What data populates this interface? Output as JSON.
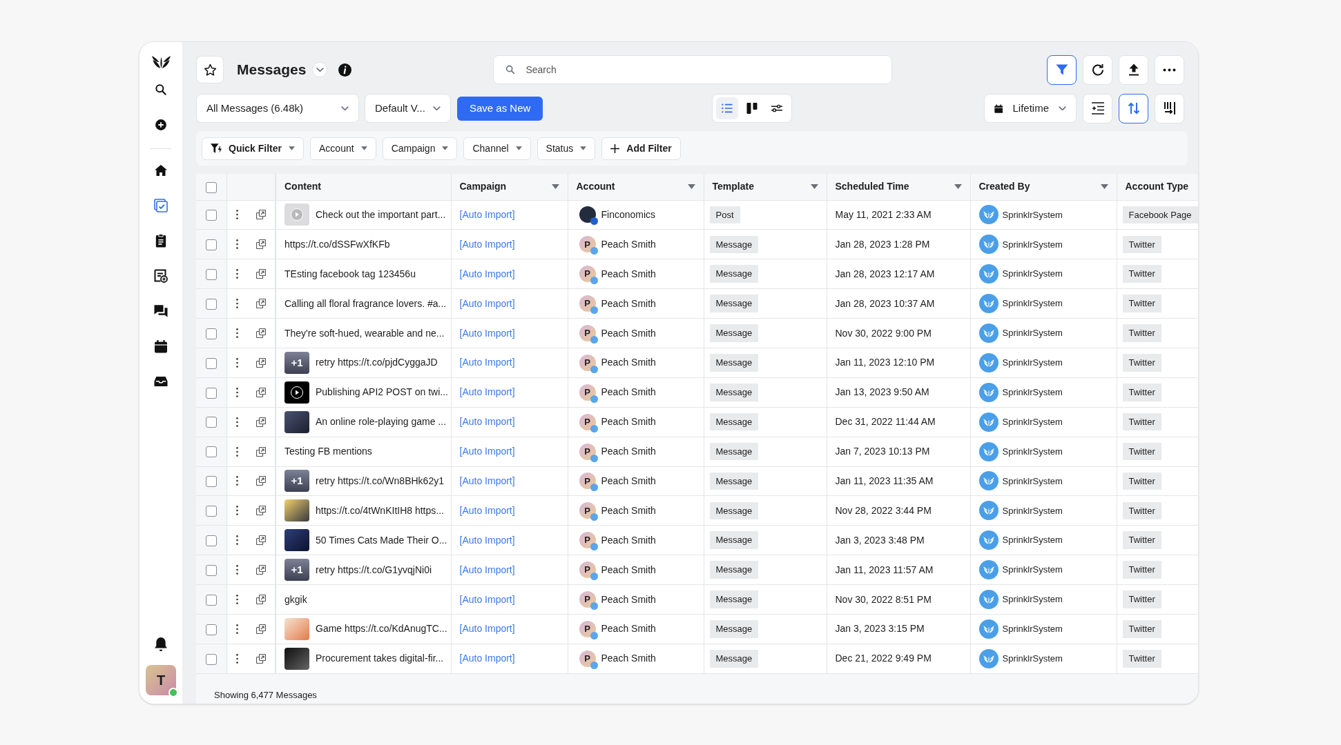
{
  "sidebar": {
    "items": [
      {
        "selected": false
      },
      {
        "selected": false
      },
      {
        "selected": false
      },
      {
        "selected": true
      },
      {
        "selected": false
      },
      {
        "selected": false
      },
      {
        "selected": false
      },
      {
        "selected": false
      },
      {
        "selected": false
      }
    ],
    "avatar_initial": "T",
    "online": true
  },
  "header": {
    "title": "Messages",
    "search": {
      "placeholder": "Search"
    },
    "actions": [
      {
        "active": true
      },
      {
        "active": false
      },
      {
        "active": false
      },
      {
        "active": false
      }
    ]
  },
  "toolbar": {
    "view_select": "All Messages (6.48k)",
    "preset_select": "Default V...",
    "save_button": "Save as New",
    "view_modes": [
      {
        "selected": true
      },
      {
        "selected": false
      },
      {
        "selected": false
      }
    ],
    "date_range": "Lifetime",
    "tools": [
      {
        "active": false
      },
      {
        "active": true
      },
      {
        "active": false
      }
    ]
  },
  "filters": [
    {
      "kind": "quick",
      "label": "Quick Filter"
    },
    {
      "kind": "dropdown",
      "label": "Account"
    },
    {
      "kind": "dropdown",
      "label": "Campaign"
    },
    {
      "kind": "dropdown",
      "label": "Channel"
    },
    {
      "kind": "dropdown",
      "label": "Status"
    },
    {
      "kind": "add",
      "label": "Add Filter"
    }
  ],
  "table": {
    "all_selected": false,
    "columns": [
      {
        "label": "Content",
        "sortable": false
      },
      {
        "label": "Campaign",
        "sortable": true
      },
      {
        "label": "Account",
        "sortable": true
      },
      {
        "label": "Template",
        "sortable": true
      },
      {
        "label": "Scheduled Time",
        "sortable": true
      },
      {
        "label": "Created By",
        "sortable": true
      },
      {
        "label": "Account Type",
        "sortable": false
      }
    ],
    "rows": [
      {
        "kind": "video",
        "checked": false,
        "content": "Check out the important part...",
        "campaign": "[Auto Import]",
        "account": {
          "name": "Finconomics",
          "color": "#1f5fd1"
        },
        "template": "Post",
        "scheduled": "May 11, 2021 2:33 AM",
        "created_by": "SprinklrSystem",
        "account_type": "Facebook Page"
      },
      {
        "kind": "text",
        "checked": false,
        "content": "https://t.co/dSSFwXfKFb",
        "campaign": "[Auto Import]",
        "account": {
          "name": "Peach Smith",
          "initial": "P",
          "color": "#5aa5ec"
        },
        "template": "Message",
        "scheduled": "Jan 28, 2023 1:28 PM",
        "created_by": "SprinklrSystem",
        "account_type": "Twitter"
      },
      {
        "kind": "text",
        "checked": false,
        "content": "TEsting facebook tag 123456u",
        "campaign": "[Auto Import]",
        "account": {
          "name": "Peach Smith",
          "initial": "P",
          "color": "#5aa5ec"
        },
        "template": "Message",
        "scheduled": "Jan 28, 2023 12:17 AM",
        "created_by": "SprinklrSystem",
        "account_type": "Twitter"
      },
      {
        "kind": "text",
        "checked": false,
        "content": "Calling all floral fragrance lovers. #a...",
        "campaign": "[Auto Import]",
        "account": {
          "name": "Peach Smith",
          "initial": "P",
          "color": "#5aa5ec"
        },
        "template": "Message",
        "scheduled": "Jan 28, 2023 10:37 AM",
        "created_by": "SprinklrSystem",
        "account_type": "Twitter"
      },
      {
        "kind": "text",
        "checked": false,
        "content": "They're soft-hued, wearable and ne...",
        "campaign": "[Auto Import]",
        "account": {
          "name": "Peach Smith",
          "initial": "P",
          "color": "#5aa5ec"
        },
        "template": "Message",
        "scheduled": "Nov 30, 2022 9:00 PM",
        "created_by": "SprinklrSystem",
        "account_type": "Twitter"
      },
      {
        "kind": "gallery",
        "badge": "+1",
        "checked": false,
        "content": "retry https://t.co/pjdCyggaJD",
        "campaign": "[Auto Import]",
        "account": {
          "name": "Peach Smith",
          "initial": "P",
          "color": "#5aa5ec"
        },
        "template": "Message",
        "scheduled": "Jan 11, 2023 12:10 PM",
        "created_by": "SprinklrSystem",
        "account_type": "Twitter"
      },
      {
        "kind": "video",
        "checked": false,
        "content": "Publishing API2 POST on twi...",
        "campaign": "[Auto Import]",
        "account": {
          "name": "Peach Smith",
          "initial": "P",
          "color": "#5aa5ec"
        },
        "template": "Message",
        "scheduled": "Jan 13, 2023 9:50 AM",
        "created_by": "SprinklrSystem",
        "account_type": "Twitter"
      },
      {
        "kind": "image",
        "checked": false,
        "content": "An online role-playing game ...",
        "campaign": "[Auto Import]",
        "account": {
          "name": "Peach Smith",
          "initial": "P",
          "color": "#5aa5ec"
        },
        "template": "Message",
        "scheduled": "Dec 31, 2022 11:44 AM",
        "created_by": "SprinklrSystem",
        "account_type": "Twitter"
      },
      {
        "kind": "text",
        "checked": false,
        "content": "Testing FB mentions",
        "campaign": "[Auto Import]",
        "account": {
          "name": "Peach Smith",
          "initial": "P",
          "color": "#5aa5ec"
        },
        "template": "Message",
        "scheduled": "Jan 7, 2023 10:13 PM",
        "created_by": "SprinklrSystem",
        "account_type": "Twitter"
      },
      {
        "kind": "gallery",
        "badge": "+1",
        "checked": false,
        "content": "retry https://t.co/Wn8BHk62y1",
        "campaign": "[Auto Import]",
        "account": {
          "name": "Peach Smith",
          "initial": "P",
          "color": "#5aa5ec"
        },
        "template": "Message",
        "scheduled": "Jan 11, 2023 11:35 AM",
        "created_by": "SprinklrSystem",
        "account_type": "Twitter"
      },
      {
        "kind": "image",
        "checked": false,
        "content": "https://t.co/4tWnKItIH8 https...",
        "campaign": "[Auto Import]",
        "account": {
          "name": "Peach Smith",
          "initial": "P",
          "color": "#5aa5ec"
        },
        "template": "Message",
        "scheduled": "Nov 28, 2022 3:44 PM",
        "created_by": "SprinklrSystem",
        "account_type": "Twitter"
      },
      {
        "kind": "image",
        "checked": false,
        "content": "50 Times Cats Made Their O...",
        "campaign": "[Auto Import]",
        "account": {
          "name": "Peach Smith",
          "initial": "P",
          "color": "#5aa5ec"
        },
        "template": "Message",
        "scheduled": "Jan 3, 2023 3:48 PM",
        "created_by": "SprinklrSystem",
        "account_type": "Twitter"
      },
      {
        "kind": "gallery",
        "badge": "+1",
        "checked": false,
        "content": "retry https://t.co/G1yvqjNi0i",
        "campaign": "[Auto Import]",
        "account": {
          "name": "Peach Smith",
          "initial": "P",
          "color": "#5aa5ec"
        },
        "template": "Message",
        "scheduled": "Jan 11, 2023 11:57 AM",
        "created_by": "SprinklrSystem",
        "account_type": "Twitter"
      },
      {
        "kind": "text",
        "checked": false,
        "content": "gkgik",
        "campaign": "[Auto Import]",
        "account": {
          "name": "Peach Smith",
          "initial": "P",
          "color": "#5aa5ec"
        },
        "template": "Message",
        "scheduled": "Nov 30, 2022 8:51 PM",
        "created_by": "SprinklrSystem",
        "account_type": "Twitter"
      },
      {
        "kind": "image",
        "checked": false,
        "content": "Game https://t.co/KdAnugTC...",
        "campaign": "[Auto Import]",
        "account": {
          "name": "Peach Smith",
          "initial": "P",
          "color": "#5aa5ec"
        },
        "template": "Message",
        "scheduled": "Jan 3, 2023 3:15 PM",
        "created_by": "SprinklrSystem",
        "account_type": "Twitter"
      },
      {
        "kind": "image",
        "checked": false,
        "content": "Procurement takes digital-fir...",
        "campaign": "[Auto Import]",
        "account": {
          "name": "Peach Smith",
          "initial": "P",
          "color": "#5aa5ec"
        },
        "template": "Message",
        "scheduled": "Dec 21, 2022 9:49 PM",
        "created_by": "SprinklrSystem",
        "account_type": "Twitter"
      }
    ]
  },
  "footer": "Showing 6,477 Messages"
}
